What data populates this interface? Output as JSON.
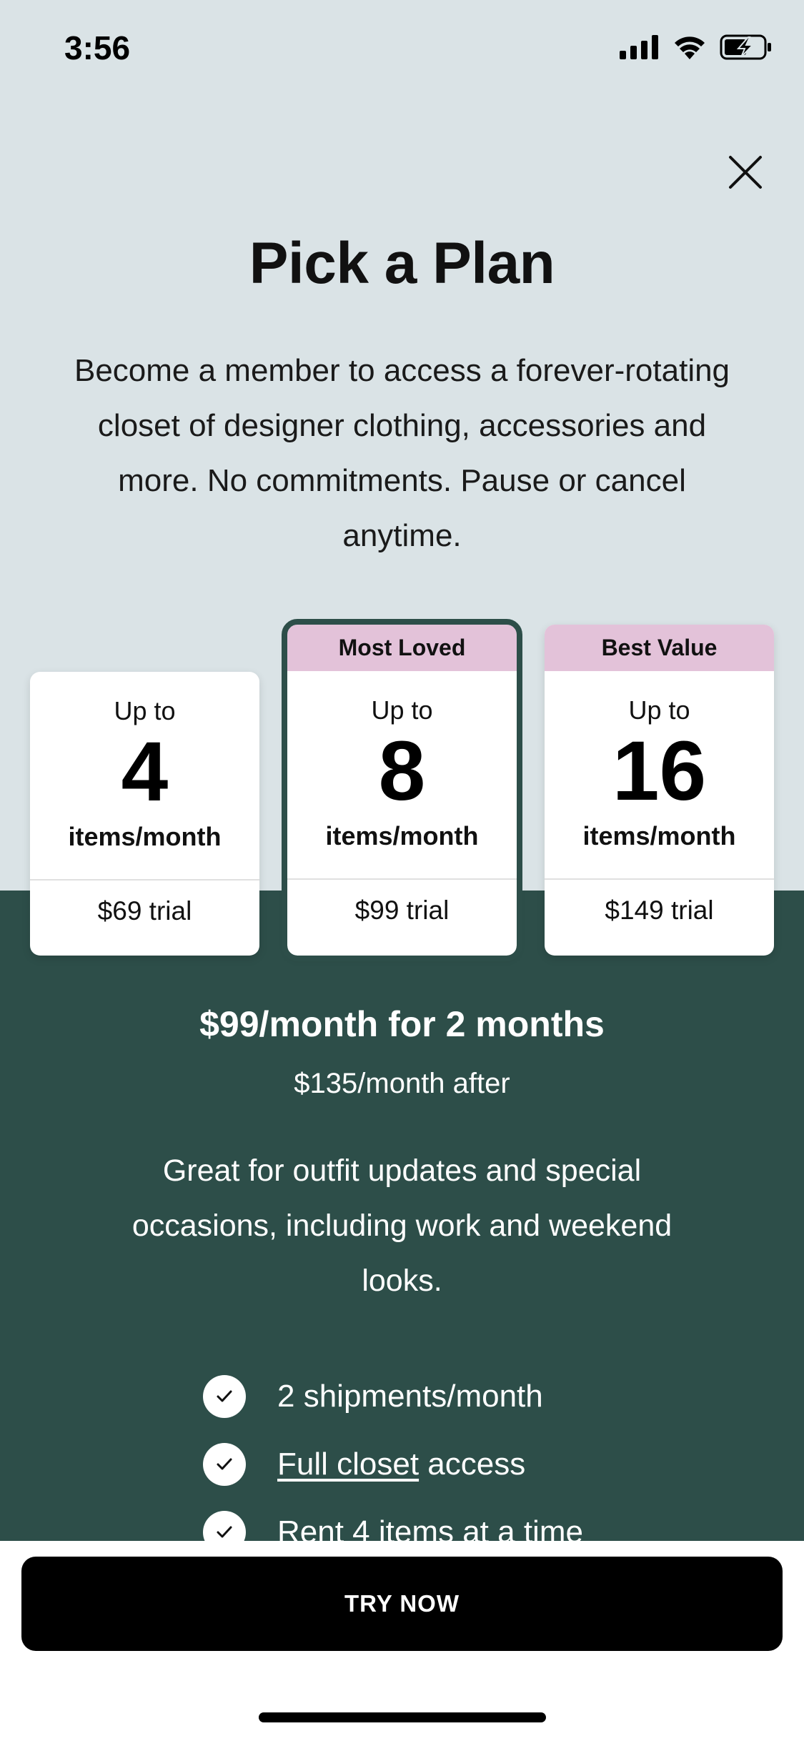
{
  "status_bar": {
    "time": "3:56"
  },
  "header": {
    "title": "Pick a Plan",
    "intro": "Become a member to access a forever-rotating closet of designer clothing, accessories and more. No commitments. Pause or cancel anytime."
  },
  "plans": [
    {
      "tag": "",
      "prefix": "Up to",
      "count": "4",
      "unit": "items/month",
      "price": "$69 trial"
    },
    {
      "tag": "Most Loved",
      "prefix": "Up to",
      "count": "8",
      "unit": "items/month",
      "price": "$99 trial",
      "selected": true
    },
    {
      "tag": "Best Value",
      "prefix": "Up to",
      "count": "16",
      "unit": "items/month",
      "price": "$149 trial"
    }
  ],
  "details": {
    "headline": "$99/month for 2 months",
    "after": "$135/month after",
    "description": "Great for outfit updates and special occasions, including work and weekend looks.",
    "features": [
      {
        "text": "2 shipments/month"
      },
      {
        "link": "Full closet",
        "text": " access"
      },
      {
        "text": "Rent 4 items at a time"
      }
    ]
  },
  "cta": {
    "label": "TRY NOW"
  },
  "colors": {
    "top_bg": "#dae3e6",
    "bottom_bg": "#2d4e49",
    "tag_bg": "#e3c2d9",
    "cta_bg": "#000000"
  },
  "icons": [
    "signal-icon",
    "wifi-icon",
    "battery-charging-icon",
    "close-icon",
    "check-icon"
  ]
}
